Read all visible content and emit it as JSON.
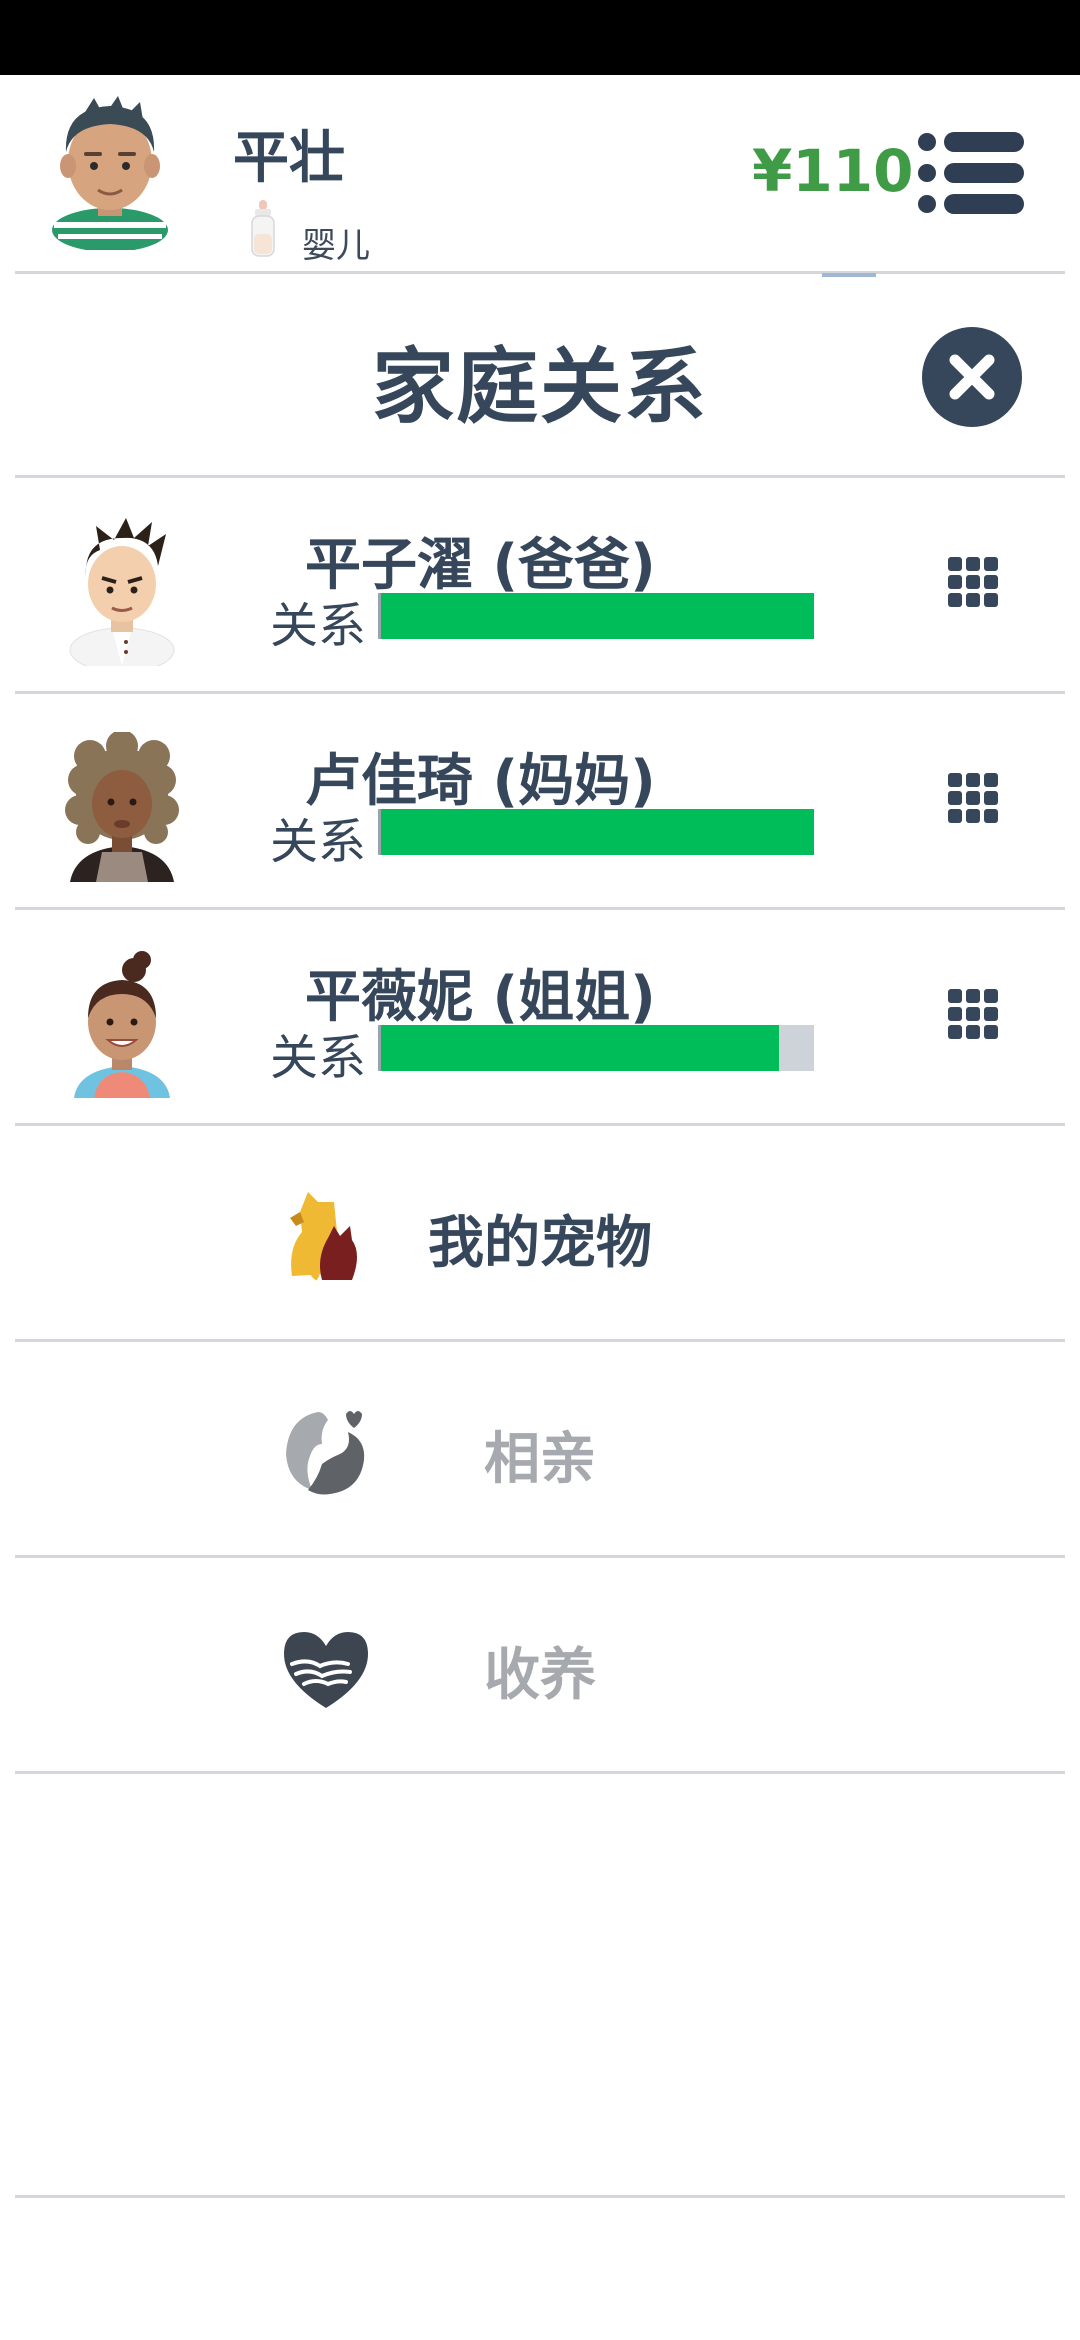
{
  "player": {
    "name": "平壮",
    "life_stage": "婴儿",
    "money": "¥110"
  },
  "panel": {
    "title": "家庭关系"
  },
  "family": [
    {
      "name": "平子濯 (爸爸)",
      "relationship_label": "关系",
      "relationship_level": 1.0
    },
    {
      "name": "卢佳琦 (妈妈)",
      "relationship_label": "关系",
      "relationship_level": 1.0
    },
    {
      "name": "平薇妮 (姐姐)",
      "relationship_label": "关系",
      "relationship_level": 0.92
    }
  ],
  "actions": [
    {
      "label": "我的宠物",
      "icon": "pet-icon",
      "enabled": true
    },
    {
      "label": "相亲",
      "icon": "dating-icon",
      "enabled": false
    },
    {
      "label": "收养",
      "icon": "adoption-icon",
      "enabled": false
    }
  ],
  "colors": {
    "money": "#3f9b46",
    "relationship_bar": "#00bd5a",
    "dark_text": "#36475b",
    "disabled_text": "#a6a9ad"
  }
}
